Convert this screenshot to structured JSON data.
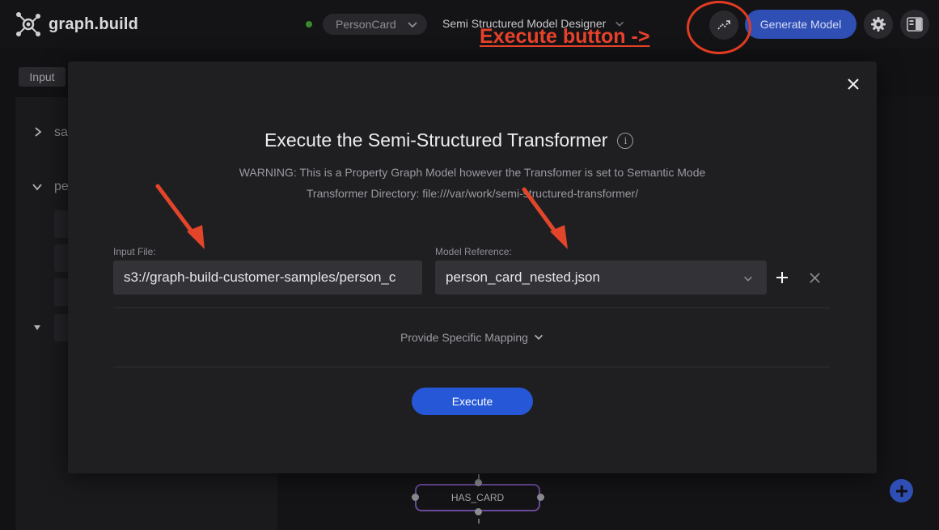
{
  "header": {
    "brand": "graph.build",
    "model_selector": "PersonCard",
    "designer_title": "Semi Structured Model Designer",
    "generate_button": "Generate Model"
  },
  "annotation": {
    "text": "Execute button ->",
    "color": "#e8412a"
  },
  "workspace": {
    "input_tab": "Input",
    "tree_rows": [
      {
        "prefix": "sa"
      },
      {
        "prefix": "pe"
      }
    ],
    "node_label": "HAS_CARD"
  },
  "modal": {
    "title": "Execute the Semi-Structured Transformer",
    "warning": "WARNING: This is a Property Graph Model however the Transfomer is set to Semantic Mode",
    "directory": "Transformer Directory: file:///var/work/semi-structured-transformer/",
    "input_file": {
      "label": "Input File:",
      "value": "s3://graph-build-customer-samples/person_c"
    },
    "model_reference": {
      "label": "Model Reference:",
      "value": "person_card_nested.json"
    },
    "mapping_toggle": "Provide Specific Mapping",
    "execute_button": "Execute"
  },
  "colors": {
    "accent": "#2557d6",
    "generate": "#2f4fb5",
    "modal_bg": "#1f1f22",
    "annotation": "#e23b22"
  },
  "icons": [
    "graph-logo-icon",
    "chevron-down-icon",
    "trend-icon",
    "gear-icon",
    "panel-icon",
    "close-icon",
    "info-icon",
    "plus-icon",
    "x-icon",
    "add-icon"
  ]
}
